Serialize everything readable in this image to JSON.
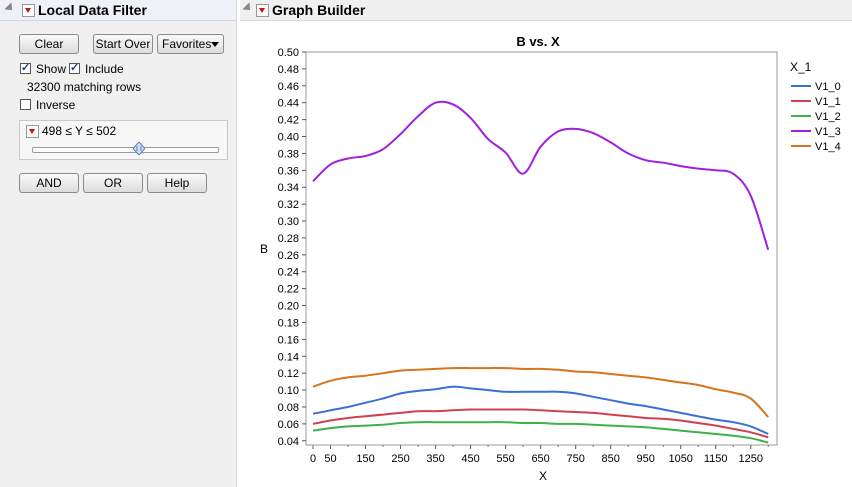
{
  "filter_panel": {
    "title": "Local Data Filter",
    "clear_label": "Clear",
    "start_over_label": "Start Over",
    "favorites_label": "Favorites",
    "show_label": "Show",
    "include_label": "Include",
    "matching_rows": "32300 matching rows",
    "inverse_label": "Inverse",
    "range_condition": "498 ≤ Y ≤ 502",
    "slider_position": 0.58,
    "and_label": "AND",
    "or_label": "OR",
    "help_label": "Help"
  },
  "graph_panel": {
    "title": "Graph Builder"
  },
  "chart_data": {
    "type": "line",
    "title": "B vs. X",
    "xlabel": "X",
    "ylabel": "B",
    "xlim": [
      -20,
      1325
    ],
    "ylim": [
      0.035,
      0.5
    ],
    "x_ticks": [
      0,
      50,
      150,
      250,
      350,
      450,
      550,
      650,
      750,
      850,
      950,
      1050,
      1150,
      1250
    ],
    "y_ticks": [
      0.04,
      0.06,
      0.08,
      0.1,
      0.12,
      0.14,
      0.16,
      0.18,
      0.2,
      0.22,
      0.24,
      0.26,
      0.28,
      0.3,
      0.32,
      0.34,
      0.36,
      0.38,
      0.4,
      0.42,
      0.44,
      0.46,
      0.48,
      0.5
    ],
    "y_tick_labels": [
      "0.04",
      "0.06",
      "0.08",
      "0.10",
      "0.12",
      "0.14",
      "0.16",
      "0.18",
      "0.20",
      "0.22",
      "0.24",
      "0.26",
      "0.28",
      "0.30",
      "0.32",
      "0.34",
      "0.36",
      "0.38",
      "0.40",
      "0.42",
      "0.44",
      "0.46",
      "0.48",
      "0.50"
    ],
    "legend_title": "X_1",
    "legend_position": "right",
    "series": [
      {
        "name": "V1_0",
        "color": "#3b6fd8",
        "x": [
          0,
          50,
          100,
          150,
          200,
          250,
          300,
          350,
          400,
          450,
          500,
          550,
          600,
          650,
          700,
          750,
          800,
          850,
          900,
          950,
          1000,
          1050,
          1100,
          1150,
          1200,
          1250,
          1300
        ],
        "values": [
          0.072,
          0.076,
          0.08,
          0.085,
          0.09,
          0.096,
          0.099,
          0.101,
          0.104,
          0.102,
          0.1,
          0.098,
          0.098,
          0.098,
          0.098,
          0.096,
          0.092,
          0.088,
          0.084,
          0.081,
          0.077,
          0.073,
          0.069,
          0.065,
          0.062,
          0.057,
          0.048
        ]
      },
      {
        "name": "V1_1",
        "color": "#d04050",
        "x": [
          0,
          50,
          100,
          150,
          200,
          250,
          300,
          350,
          400,
          450,
          500,
          550,
          600,
          650,
          700,
          750,
          800,
          850,
          900,
          950,
          1000,
          1050,
          1100,
          1150,
          1200,
          1250,
          1300
        ],
        "values": [
          0.06,
          0.064,
          0.067,
          0.069,
          0.071,
          0.073,
          0.075,
          0.075,
          0.076,
          0.077,
          0.077,
          0.077,
          0.077,
          0.076,
          0.075,
          0.074,
          0.073,
          0.071,
          0.069,
          0.067,
          0.066,
          0.064,
          0.061,
          0.058,
          0.054,
          0.05,
          0.044
        ]
      },
      {
        "name": "V1_2",
        "color": "#3bb24a",
        "x": [
          0,
          50,
          100,
          150,
          200,
          250,
          300,
          350,
          400,
          450,
          500,
          550,
          600,
          650,
          700,
          750,
          800,
          850,
          900,
          950,
          1000,
          1050,
          1100,
          1150,
          1200,
          1250,
          1300
        ],
        "values": [
          0.052,
          0.055,
          0.057,
          0.058,
          0.059,
          0.061,
          0.062,
          0.062,
          0.062,
          0.062,
          0.062,
          0.062,
          0.061,
          0.061,
          0.06,
          0.06,
          0.059,
          0.058,
          0.057,
          0.056,
          0.054,
          0.052,
          0.05,
          0.048,
          0.046,
          0.043,
          0.038
        ]
      },
      {
        "name": "V1_3",
        "color": "#a020e0",
        "x": [
          0,
          50,
          100,
          150,
          200,
          250,
          300,
          350,
          400,
          450,
          500,
          550,
          600,
          650,
          700,
          750,
          800,
          850,
          900,
          950,
          1000,
          1050,
          1100,
          1150,
          1200,
          1250,
          1300
        ],
        "values": [
          0.347,
          0.367,
          0.374,
          0.377,
          0.385,
          0.403,
          0.424,
          0.44,
          0.438,
          0.422,
          0.397,
          0.381,
          0.356,
          0.388,
          0.406,
          0.409,
          0.404,
          0.393,
          0.38,
          0.372,
          0.369,
          0.365,
          0.362,
          0.36,
          0.356,
          0.33,
          0.266
        ]
      },
      {
        "name": "V1_4",
        "color": "#d6751e",
        "x": [
          0,
          50,
          100,
          150,
          200,
          250,
          300,
          350,
          400,
          450,
          500,
          550,
          600,
          650,
          700,
          750,
          800,
          850,
          900,
          950,
          1000,
          1050,
          1100,
          1150,
          1200,
          1250,
          1300
        ],
        "values": [
          0.104,
          0.111,
          0.115,
          0.117,
          0.12,
          0.123,
          0.124,
          0.125,
          0.126,
          0.126,
          0.126,
          0.126,
          0.125,
          0.125,
          0.124,
          0.122,
          0.121,
          0.119,
          0.117,
          0.115,
          0.112,
          0.109,
          0.106,
          0.101,
          0.097,
          0.09,
          0.068
        ]
      }
    ]
  }
}
